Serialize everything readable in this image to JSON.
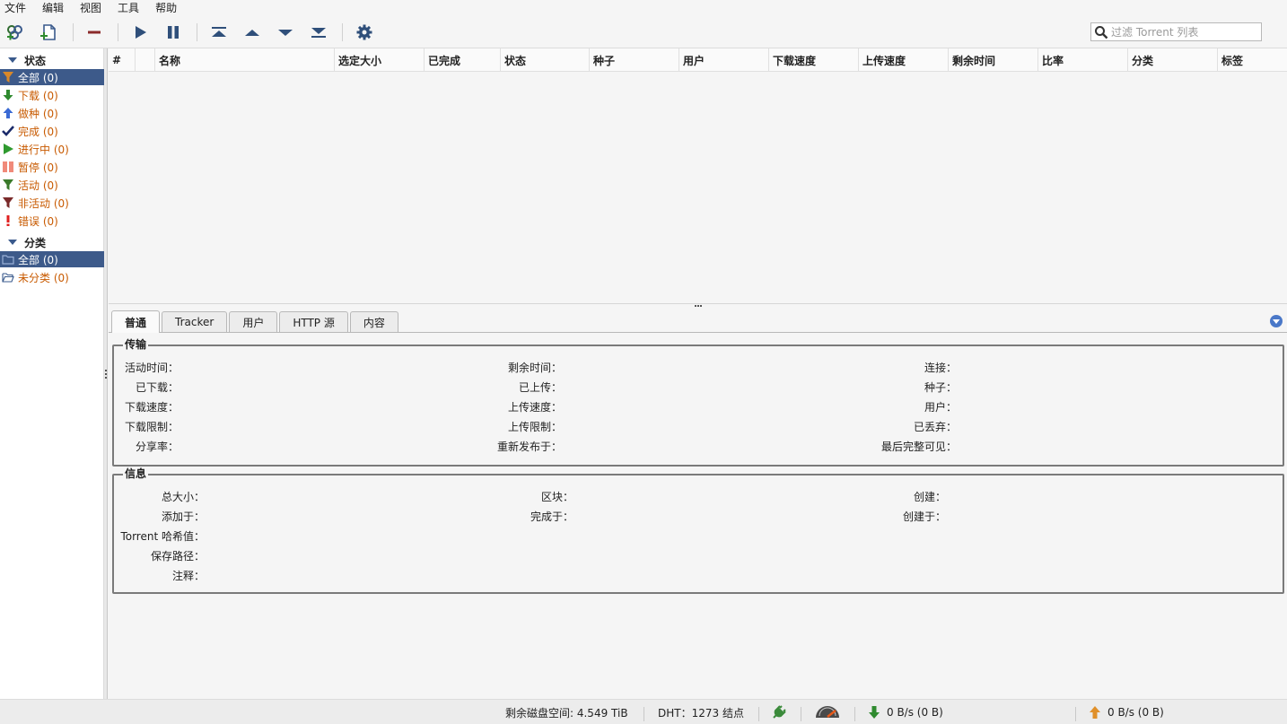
{
  "menu": [
    "文件",
    "编辑",
    "视图",
    "工具",
    "帮助"
  ],
  "toolbar": {
    "search_placeholder": "过滤 Torrent 列表"
  },
  "sidebar": {
    "status_header": "状态",
    "status_items": [
      {
        "label": "全部 (0)",
        "icon": "filter-icon",
        "selected": true
      },
      {
        "label": "下载 (0)",
        "icon": "download-arrow-icon"
      },
      {
        "label": "做种 (0)",
        "icon": "upload-arrow-icon"
      },
      {
        "label": "完成 (0)",
        "icon": "checkmark-icon"
      },
      {
        "label": "进行中 (0)",
        "icon": "play-icon"
      },
      {
        "label": "暂停 (0)",
        "icon": "pause-icon"
      },
      {
        "label": "活动 (0)",
        "icon": "filter-active-icon"
      },
      {
        "label": "非活动 (0)",
        "icon": "filter-inactive-icon"
      },
      {
        "label": "错误 (0)",
        "icon": "error-icon"
      }
    ],
    "category_header": "分类",
    "category_items": [
      {
        "label": "全部 (0)",
        "icon": "folder-icon",
        "selected": true
      },
      {
        "label": "未分类 (0)",
        "icon": "folder-open-icon"
      }
    ]
  },
  "table": {
    "columns": [
      "#",
      "",
      "名称",
      "选定大小",
      "已完成",
      "状态",
      "种子",
      "用户",
      "下载速度",
      "上传速度",
      "剩余时间",
      "比率",
      "分类",
      "标签"
    ]
  },
  "tabs": [
    "普通",
    "Tracker",
    "用户",
    "HTTP 源",
    "内容"
  ],
  "transfer": {
    "title": "传输",
    "col1": [
      "活动时间：",
      "已下载：",
      "下载速度：",
      "下载限制：",
      "分享率："
    ],
    "col2": [
      "剩余时间：",
      "已上传：",
      "上传速度：",
      "上传限制：",
      "重新发布于："
    ],
    "col3": [
      "连接：",
      "种子：",
      "用户：",
      "已丢弃：",
      "最后完整可见："
    ]
  },
  "info": {
    "title": "信息",
    "col1": [
      "总大小：",
      "添加于：",
      "Torrent 哈希值：",
      "保存路径：",
      "注释："
    ],
    "col2": [
      "区块：",
      "完成于："
    ],
    "col3": [
      "创建：",
      "创建于："
    ]
  },
  "status": {
    "free_space": "剩余磁盘空间: 4.549 TiB",
    "dht": "DHT：1273 结点",
    "download": "0 B/s (0 B)",
    "upload": "0 B/s (0 B)"
  }
}
